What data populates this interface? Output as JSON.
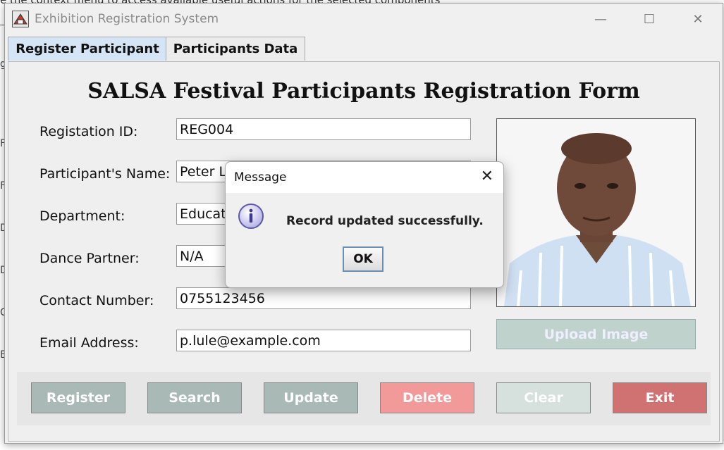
{
  "background": {
    "text": "e the context menu to access available useful actions for the selected components",
    "letters": [
      "g",
      "F",
      "F",
      "D",
      "D",
      "C",
      "E"
    ]
  },
  "window": {
    "title": "Exhibition Registration System",
    "minimize": "—",
    "maximize": "☐",
    "close": "✕"
  },
  "tabs": [
    {
      "label": "Register Participant",
      "active": true
    },
    {
      "label": "Participants Data",
      "active": false
    }
  ],
  "form": {
    "title": "SALSA Festival Participants Registration Form",
    "fields": [
      {
        "label": "Registation ID:",
        "value": "REG004"
      },
      {
        "label": "Participant's Name:",
        "value": "Peter Lu"
      },
      {
        "label": "Department:",
        "value": "Educati"
      },
      {
        "label": "Dance Partner:",
        "value": "N/A"
      },
      {
        "label": "Contact Number:",
        "value": "0755123456"
      },
      {
        "label": "Email Address:",
        "value": "p.lule@example.com"
      }
    ],
    "upload_label": "Upload Image"
  },
  "actions": [
    {
      "label": "Register",
      "color": "#a9b9b5"
    },
    {
      "label": "Search",
      "color": "#a9b9b5"
    },
    {
      "label": "Update",
      "color": "#a9b9b5"
    },
    {
      "label": "Delete",
      "color": "#f29a9a"
    },
    {
      "label": "Clear",
      "color": "#d6e1dd"
    },
    {
      "label": "Exit",
      "color": "#d07272"
    }
  ],
  "dialog": {
    "title": "Message",
    "close": "✕",
    "message": "Record updated successfully.",
    "ok_label": "OK",
    "icon": "information-icon"
  }
}
